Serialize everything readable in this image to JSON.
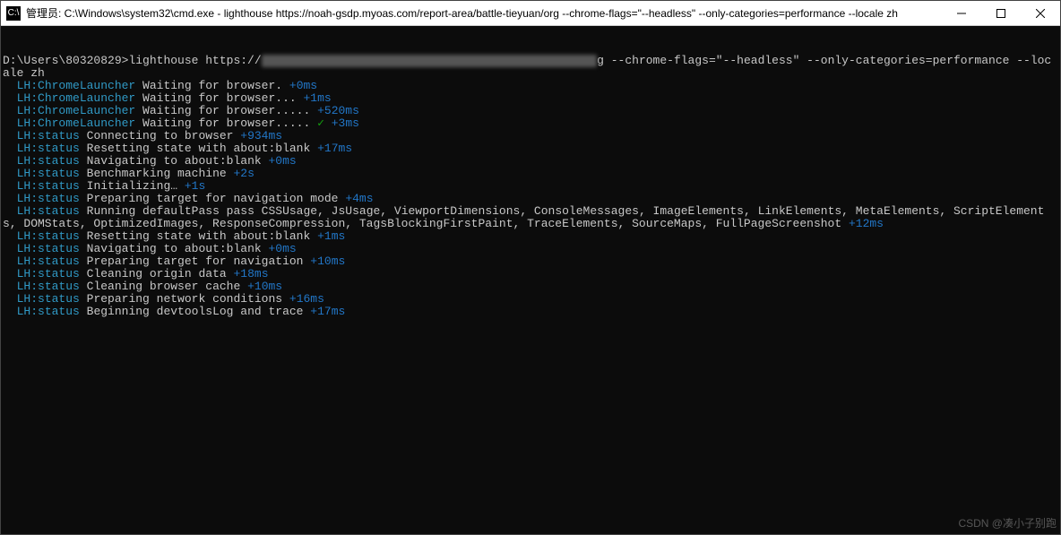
{
  "window": {
    "title_prefix": "管理员: C:\\Windows\\system32\\cmd.exe - lighthouse  https://noah-gsdp.myoas.com/report-area/battle-tieyuan/org --chrome-flags=\"--headless\" --only-categories=performance --locale zh",
    "icon_text": "C:\\"
  },
  "terminal": {
    "prompt_prefix": "D:\\Users\\80320829>",
    "command_visible_pre": "lighthouse https://",
    "command_blur": "████ ████ ████████ ██████ ████ ████████ ████████",
    "command_visible_post": "g --chrome-flags=\"--headless\" --only-categories=performance --locale zh",
    "lines": [
      {
        "tag": "LH:ChromeLauncher",
        "msg": "Waiting for browser.",
        "suffix": "+0ms",
        "suffix_class": "c-blue"
      },
      {
        "tag": "LH:ChromeLauncher",
        "msg": "Waiting for browser...",
        "suffix": "+1ms",
        "suffix_class": "c-blue"
      },
      {
        "tag": "LH:ChromeLauncher",
        "msg": "Waiting for browser.....",
        "suffix": "+520ms",
        "suffix_class": "c-blue"
      },
      {
        "tag": "LH:ChromeLauncher",
        "msg": "Waiting for browser.....",
        "check": "✓",
        "suffix": "+3ms",
        "suffix_class": "c-blue"
      },
      {
        "tag": "LH:status",
        "msg": "Connecting to browser",
        "suffix": "+934ms",
        "suffix_class": "c-blue"
      },
      {
        "tag": "LH:status",
        "msg": "Resetting state with about:blank",
        "suffix": "+17ms",
        "suffix_class": "c-blue"
      },
      {
        "tag": "LH:status",
        "msg": "Navigating to about:blank",
        "suffix": "+0ms",
        "suffix_class": "c-blue"
      },
      {
        "tag": "LH:status",
        "msg": "Benchmarking machine",
        "suffix": "+2s",
        "suffix_class": "c-blue"
      },
      {
        "tag": "LH:status",
        "msg": "Initializing…",
        "suffix": "+1s",
        "suffix_class": "c-blue"
      },
      {
        "tag": "LH:status",
        "msg": "Preparing target for navigation mode",
        "suffix": "+4ms",
        "suffix_class": "c-blue"
      },
      {
        "tag": "LH:status",
        "msg_wrap": true,
        "msg": "Running defaultPass pass CSSUsage, JsUsage, ViewportDimensions, ConsoleMessages, ImageElements, LinkElements, MetaElements, ScriptElements, DOMStats, OptimizedImages, ResponseCompression, TagsBlockingFirstPaint, TraceElements, SourceMaps, FullPageScreenshot",
        "suffix": "+12ms",
        "suffix_class": "c-blue"
      },
      {
        "tag": "LH:status",
        "msg": "Resetting state with about:blank",
        "suffix": "+1ms",
        "suffix_class": "c-blue"
      },
      {
        "tag": "LH:status",
        "msg": "Navigating to about:blank",
        "suffix": "+0ms",
        "suffix_class": "c-blue"
      },
      {
        "tag": "LH:status",
        "msg": "Preparing target for navigation",
        "suffix": "+10ms",
        "suffix_class": "c-blue"
      },
      {
        "tag": "LH:status",
        "msg": "Cleaning origin data",
        "suffix": "+18ms",
        "suffix_class": "c-blue"
      },
      {
        "tag": "LH:status",
        "msg": "Cleaning browser cache",
        "suffix": "+10ms",
        "suffix_class": "c-blue"
      },
      {
        "tag": "LH:status",
        "msg": "Preparing network conditions",
        "suffix": "+16ms",
        "suffix_class": "c-blue"
      },
      {
        "tag": "LH:status",
        "msg": "Beginning devtoolsLog and trace",
        "suffix": "+17ms",
        "suffix_class": "c-blue"
      }
    ]
  },
  "watermark": "CSDN @凑小子别跑"
}
